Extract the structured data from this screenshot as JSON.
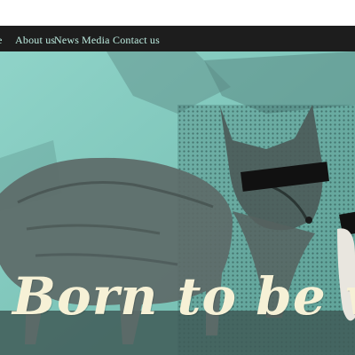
{
  "nav": {
    "items": [
      {
        "label": "e",
        "name": "nav-home-partial"
      },
      {
        "label": "About us",
        "name": "nav-about-us"
      },
      {
        "label": "News",
        "name": "nav-news"
      },
      {
        "label": "Media",
        "name": "nav-media"
      },
      {
        "label": "Contact us",
        "name": "nav-contact-us"
      }
    ]
  },
  "hero": {
    "headline": "Born to be wild",
    "image": "fox-and-deer-illustration"
  },
  "colors": {
    "nav_bg": "#1d1d1d",
    "nav_text": "#bfeee2",
    "teal": "#7ec8bd",
    "headline": "#f6f1d6"
  }
}
